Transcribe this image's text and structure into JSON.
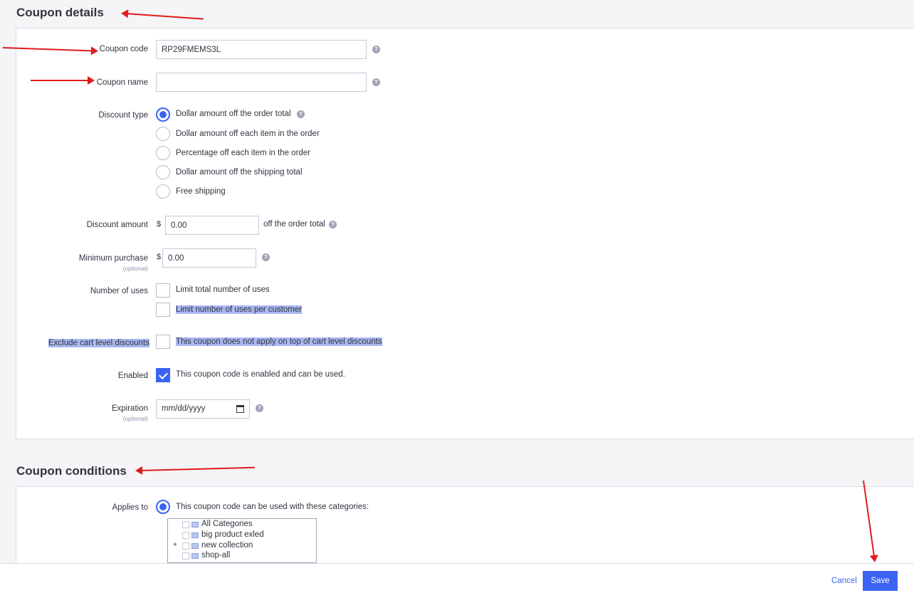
{
  "details": {
    "title": "Coupon details",
    "coupon_code_label": "Coupon code",
    "coupon_code_value": "RP29FMEMS3L",
    "coupon_name_label": "Coupon name",
    "coupon_name_value": "",
    "discount_type_label": "Discount type",
    "discount_types": [
      "Dollar amount off the order total",
      "Dollar amount off each item in the order",
      "Percentage off each item in the order",
      "Dollar amount off the shipping total",
      "Free shipping"
    ],
    "discount_type_selected": "Dollar amount off the order total",
    "discount_amount_label": "Discount amount",
    "currency_symbol": "$",
    "discount_amount_value": "0.00",
    "discount_amount_suffix": "off the order total",
    "min_purchase_label": "Minimum purchase",
    "optional_label": "(optional)",
    "min_purchase_value": "0.00",
    "uses_label": "Number of uses",
    "limit_total_label": "Limit total number of uses",
    "limit_per_customer_label": "Limit number of uses per customer",
    "exclude_label": "Exclude cart level discounts",
    "exclude_text": "This coupon does not apply on top of cart level discounts",
    "enabled_label": "Enabled",
    "enabled_text": "This coupon code is enabled and can be used.",
    "enabled": true,
    "expiration_label": "Expiration",
    "expiration_placeholder": "mm/dd/yyyy"
  },
  "conditions": {
    "title": "Coupon conditions",
    "applies_to_label": "Applies to",
    "applies_to_text": "This coupon code can be used with these categories:",
    "categories": [
      "All Categories",
      "big product exled",
      "new collection",
      "shop-all"
    ]
  },
  "footer": {
    "cancel_label": "Cancel",
    "save_label": "Save"
  },
  "colors": {
    "accent": "#3c64f4",
    "annotation_arrow": "#e01b1b",
    "highlight": "#a9b8f0"
  }
}
